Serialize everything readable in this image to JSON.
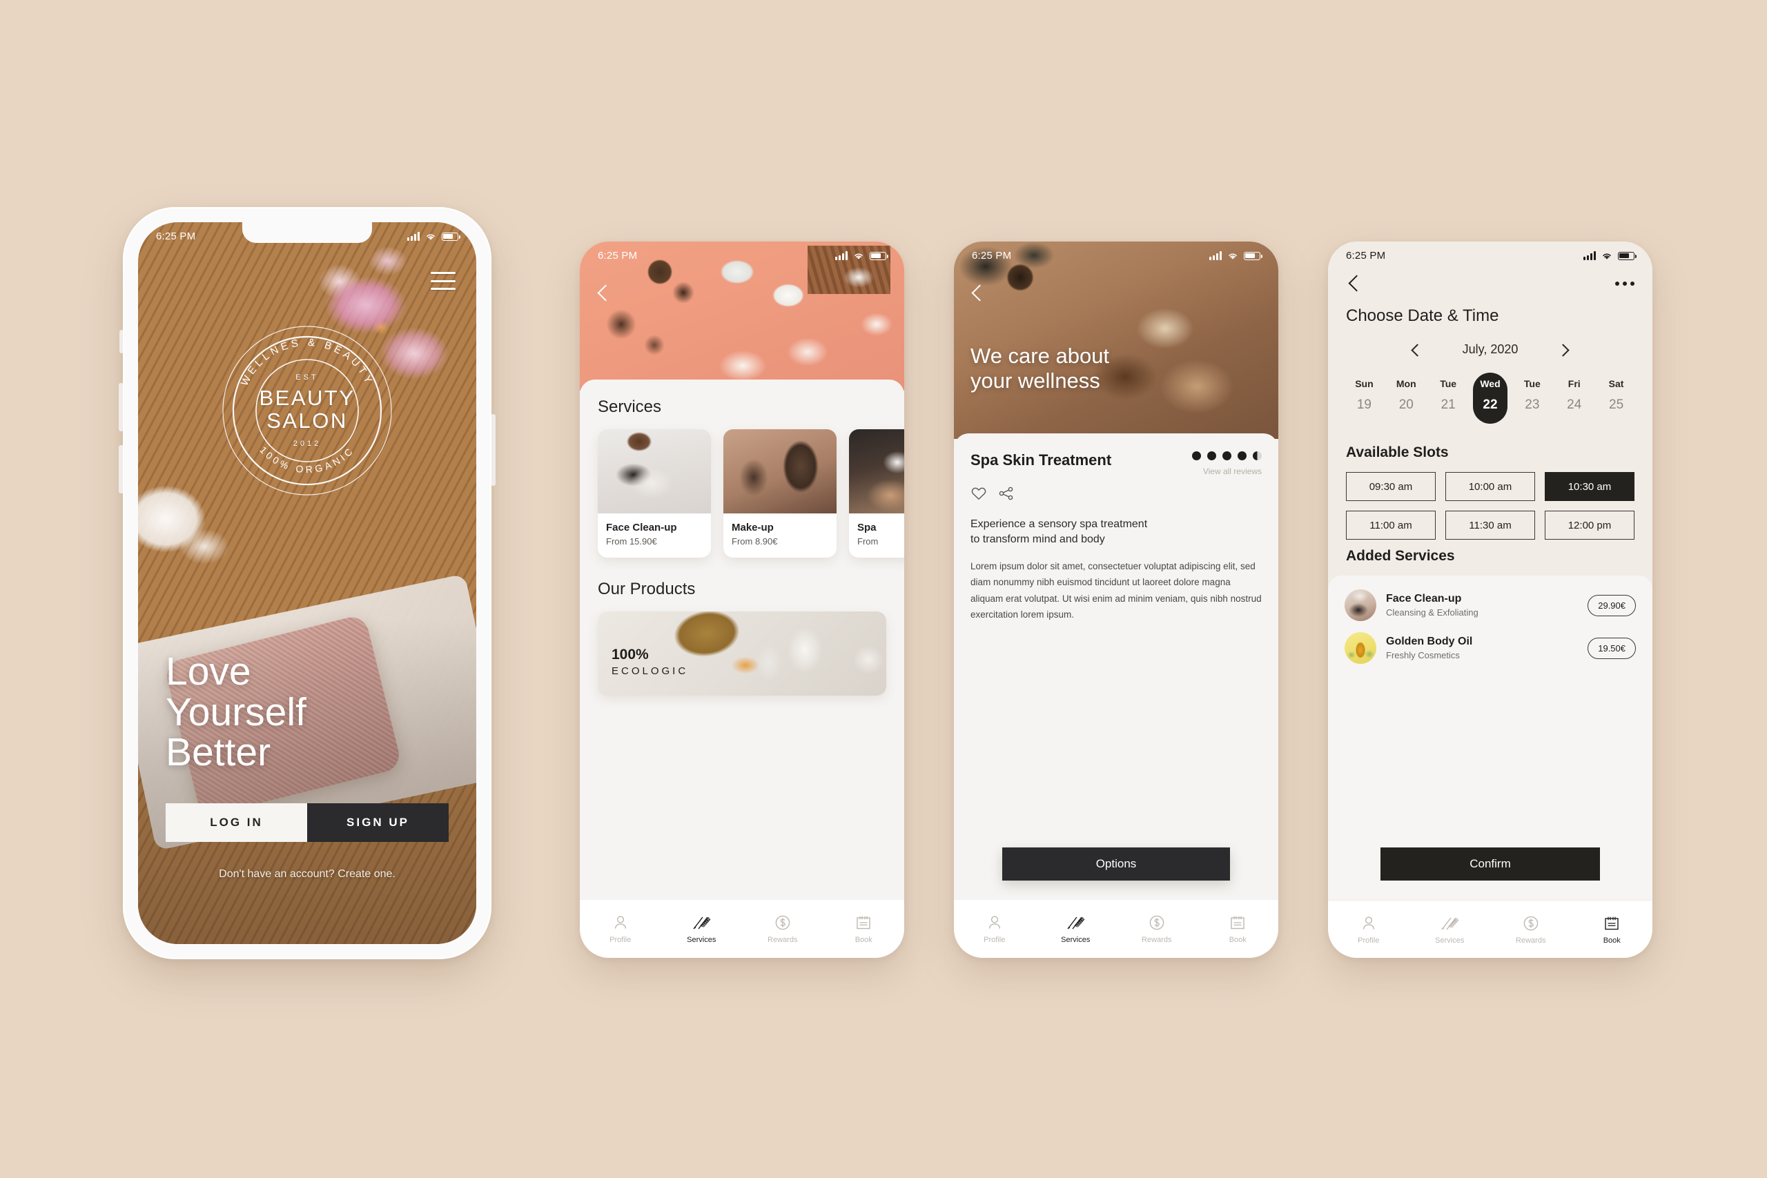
{
  "meta": {
    "page_background": "#e8d6c3",
    "accent_dark": "#24221f",
    "accent_light": "#f7f5f2"
  },
  "status_bar": {
    "time": "6:25 PM",
    "icons": {
      "signal": "signal-bars-icon",
      "wifi": "wifi-icon",
      "battery": "battery-icon"
    }
  },
  "phone1": {
    "name": "welcome-screen",
    "menu_icon": "hamburger-menu-icon",
    "logo": {
      "arc_top": "WELLNES & BEAUTY",
      "arc_bottom": "100% ORGANIC",
      "est": "EST",
      "line1": "BEAUTY",
      "line2": "SALON",
      "year": "2012"
    },
    "headline_lines": [
      "Love",
      "Yourself",
      "Better"
    ],
    "login_label": "LOG IN",
    "signup_label": "SIGN UP",
    "create_account_note": "Don't have an account? Create one."
  },
  "phone2": {
    "name": "services-screen",
    "back_icon": "chevron-left-icon",
    "services_title": "Services",
    "services": [
      {
        "name": "Face Clean-up",
        "price": "From 15.90€"
      },
      {
        "name": "Make-up",
        "price": "From 8.90€"
      },
      {
        "name": "Spa",
        "price": "From"
      }
    ],
    "products_title": "Our Products",
    "product_banner": {
      "percent": "100%",
      "label": "ECOLOGIC"
    }
  },
  "phone3": {
    "name": "service-detail-screen",
    "back_icon": "chevron-left-icon",
    "hero_lines": [
      "We care about",
      "your wellness"
    ],
    "service_title": "Spa Skin Treatment",
    "rating": 4.5,
    "rating_max": 5,
    "reviews_link": "View all reviews",
    "favorite_icon": "heart-icon",
    "share_icon": "share-icon",
    "lead_lines": [
      "Experience a sensory spa treatment",
      "to transform mind and body"
    ],
    "body_text": "Lorem ipsum dolor sit amet, consectetuer voluptat adipiscing elit, sed diam nonummy nibh euismod tincidunt ut laoreet dolore magna aliquam erat volutpat. Ut wisi enim ad minim veniam, quis nibh nostrud exercitation lorem ipsum.",
    "options_label": "Options"
  },
  "phone4": {
    "name": "booking-screen",
    "back_icon": "chevron-left-icon",
    "more_icon": "more-horizontal-icon",
    "page_title": "Choose Date & Time",
    "month_label": "July, 2020",
    "prev_icon": "chevron-left-icon",
    "next_icon": "chevron-right-icon",
    "calendar": {
      "days": [
        {
          "dow": "Sun",
          "num": "19",
          "selected": false
        },
        {
          "dow": "Mon",
          "num": "20",
          "selected": false
        },
        {
          "dow": "Tue",
          "num": "21",
          "selected": false
        },
        {
          "dow": "Wed",
          "num": "22",
          "selected": true
        },
        {
          "dow": "Tue",
          "num": "23",
          "selected": false
        },
        {
          "dow": "Fri",
          "num": "24",
          "selected": false
        },
        {
          "dow": "Sat",
          "num": "25",
          "selected": false
        }
      ]
    },
    "slots_title": "Available Slots",
    "slots": [
      {
        "label": "09:30 am",
        "selected": false
      },
      {
        "label": "10:00 am",
        "selected": false
      },
      {
        "label": "10:30 am",
        "selected": true
      },
      {
        "label": "11:00 am",
        "selected": false
      },
      {
        "label": "11:30 am",
        "selected": false
      },
      {
        "label": "12:00 pm",
        "selected": false
      }
    ],
    "added_title": "Added Services",
    "added_services": [
      {
        "name": "Face Clean-up",
        "sub": "Cleansing & Exfoliating",
        "price": "29.90€"
      },
      {
        "name": "Golden Body Oil",
        "sub": "Freshly Cosmetics",
        "price": "19.50€"
      }
    ],
    "confirm_label": "Confirm"
  },
  "tabbar": {
    "items": [
      {
        "label": "Profile",
        "icon": "user-icon"
      },
      {
        "label": "Services",
        "icon": "brush-comb-icon"
      },
      {
        "label": "Rewards",
        "icon": "dollar-circle-icon"
      },
      {
        "label": "Book",
        "icon": "calendar-icon"
      }
    ],
    "active_phone2": "Services",
    "active_phone3": "Services",
    "active_phone4": "Book"
  }
}
